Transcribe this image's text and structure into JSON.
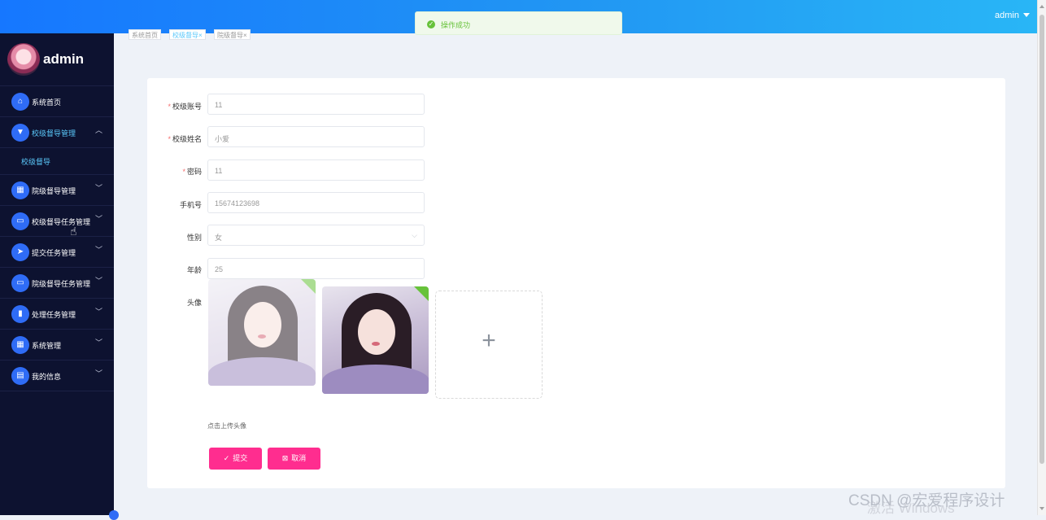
{
  "header": {
    "user_label": "admin"
  },
  "toast": {
    "message": "操作成功"
  },
  "sidebar": {
    "user_name": "admin",
    "items": [
      {
        "label": "系统首页",
        "icon": "home-icon",
        "glyph": "⌂",
        "expandable": false
      },
      {
        "label": "校级督导管理",
        "icon": "funnel-icon",
        "glyph": "▼",
        "expandable": true,
        "active": true,
        "expanded": true
      },
      {
        "label": "院级督导管理",
        "icon": "grid-icon",
        "glyph": "▦",
        "expandable": true
      },
      {
        "label": "校级督导任务管理",
        "icon": "monitor-icon",
        "glyph": "▭",
        "expandable": true
      },
      {
        "label": "提交任务管理",
        "icon": "send-icon",
        "glyph": "➤",
        "expandable": true
      },
      {
        "label": "院级督导任务管理",
        "icon": "monitor-icon",
        "glyph": "▭",
        "expandable": true
      },
      {
        "label": "处理任务管理",
        "icon": "bar-chart-icon",
        "glyph": "▮",
        "expandable": true
      },
      {
        "label": "系统管理",
        "icon": "grid-icon",
        "glyph": "▦",
        "expandable": true
      },
      {
        "label": "我的信息",
        "icon": "card-icon",
        "glyph": "▤",
        "expandable": true
      }
    ],
    "submenu": {
      "label": "校级督导"
    }
  },
  "tabs": [
    {
      "label": "系统首页"
    },
    {
      "label": "校级督导×",
      "active": true
    },
    {
      "label": "院级督导×"
    }
  ],
  "form": {
    "account": {
      "label": "校级账号",
      "value": "11",
      "required": true
    },
    "name": {
      "label": "校级姓名",
      "value": "小爱",
      "required": true
    },
    "password": {
      "label": "密码",
      "value": "11",
      "required": true
    },
    "phone": {
      "label": "手机号",
      "value": "15674123698",
      "required": false
    },
    "gender": {
      "label": "性别",
      "value": "女",
      "required": false
    },
    "age": {
      "label": "年龄",
      "value": "25",
      "required": false
    },
    "avatar": {
      "label": "头像",
      "hint": "点击上传头像"
    }
  },
  "actions": {
    "submit_label": "提交",
    "cancel_label": "取消"
  },
  "overlay": {
    "watermark": "CSDN @宏爱程序设计",
    "activate": "激活 Windows"
  }
}
